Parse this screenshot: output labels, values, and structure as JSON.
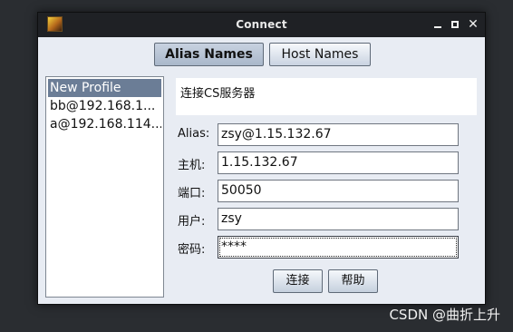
{
  "window": {
    "title": "Connect"
  },
  "tabs": {
    "alias": "Alias Names",
    "host": "Host Names"
  },
  "profiles": [
    "New Profile",
    "bb@192.168.1...",
    "a@192.168.114..."
  ],
  "selected_profile_index": 0,
  "info_text": "连接CS服务器",
  "form": {
    "alias_label": "Alias:",
    "alias_value": "zsy@1.15.132.67",
    "host_label": "主机:",
    "host_value": "1.15.132.67",
    "port_label": "端口:",
    "port_value": "50050",
    "user_label": "用户:",
    "user_value": "zsy",
    "password_label": "密码:",
    "password_value": "****"
  },
  "buttons": {
    "connect": "连接",
    "help": "帮助"
  },
  "watermark": "CSDN @曲折上升"
}
